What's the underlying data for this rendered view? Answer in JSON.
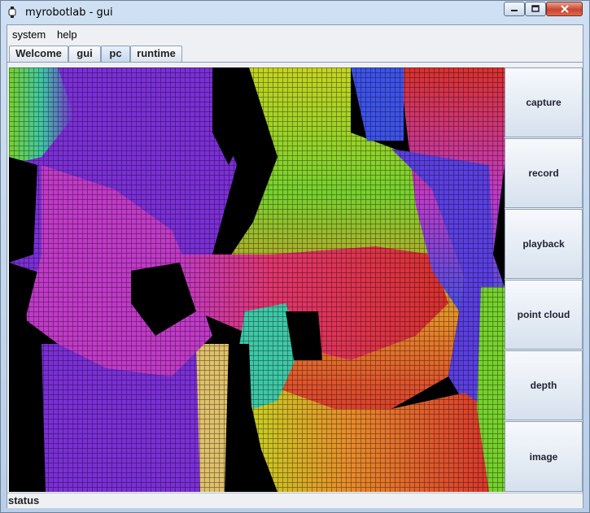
{
  "window": {
    "title": "myrobotlab - gui"
  },
  "menubar": {
    "items": [
      "system",
      "help"
    ]
  },
  "tabs": [
    {
      "label": "Welcome",
      "active": false
    },
    {
      "label": "gui",
      "active": false
    },
    {
      "label": "pc",
      "active": true
    },
    {
      "label": "runtime",
      "active": false
    }
  ],
  "controls": {
    "buttons": [
      "capture",
      "record",
      "playback",
      "point cloud",
      "depth",
      "image"
    ]
  },
  "statusbar": {
    "text": "status"
  },
  "colors": {
    "magenta": "#c03ac8",
    "purple": "#7b2fd6",
    "blue": "#3d52e6",
    "green": "#76d12d",
    "yellow": "#c5d321",
    "orange": "#e68e2a",
    "red": "#d8312d",
    "teal": "#3ec7a6"
  }
}
